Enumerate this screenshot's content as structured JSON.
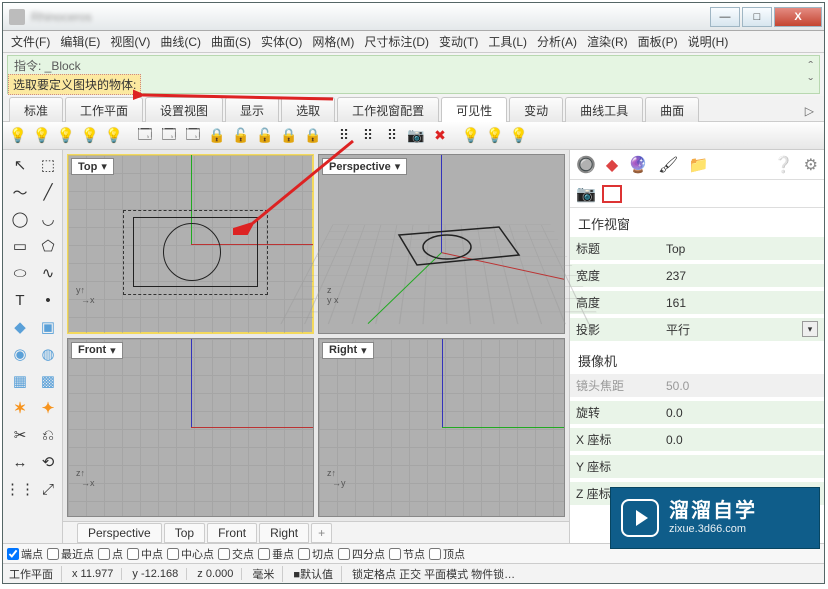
{
  "titlebar": {
    "title": "Rhinoceros"
  },
  "win_buttons": {
    "min": "—",
    "max": "□",
    "close": "X"
  },
  "menus": [
    "文件(F)",
    "编辑(E)",
    "视图(V)",
    "曲线(C)",
    "曲面(S)",
    "实体(O)",
    "网格(M)",
    "尺寸标注(D)",
    "变动(T)",
    "工具(L)",
    "分析(A)",
    "渲染(R)",
    "面板(P)",
    "说明(H)"
  ],
  "command": {
    "line1": "指令: _Block",
    "line2": "选取要定义图块的物体:"
  },
  "upper_tabs": [
    "标准",
    "工作平面",
    "设置视图",
    "显示",
    "选取",
    "工作视窗配置",
    "可见性",
    "变动",
    "曲线工具",
    "曲面"
  ],
  "upper_active_index": 6,
  "tab_more": "▷",
  "viewports": {
    "top": "Top",
    "perspective": "Perspective",
    "front": "Front",
    "right": "Right"
  },
  "view_tabs": [
    "Perspective",
    "Top",
    "Front",
    "Right"
  ],
  "view_tab_plus": "+",
  "right_panel": {
    "section1": "工作视窗",
    "rows1": [
      {
        "k": "标题",
        "v": "Top"
      },
      {
        "k": "宽度",
        "v": "237"
      },
      {
        "k": "高度",
        "v": "161"
      },
      {
        "k": "投影",
        "v": "平行",
        "dd": true
      }
    ],
    "section2": "摄像机",
    "rows2": [
      {
        "k": "镜头焦距",
        "v": "50.0",
        "dim": true
      },
      {
        "k": "旋转",
        "v": "0.0"
      },
      {
        "k": "X 座标",
        "v": "0.0"
      },
      {
        "k": "Y 座标",
        "v": ""
      },
      {
        "k": "Z 座标",
        "v": ""
      }
    ]
  },
  "osnap": {
    "items": [
      {
        "label": "端点",
        "checked": true
      },
      {
        "label": "最近点",
        "checked": false
      },
      {
        "label": "点",
        "checked": false
      },
      {
        "label": "中点",
        "checked": false
      },
      {
        "label": "中心点",
        "checked": false
      },
      {
        "label": "交点",
        "checked": false
      },
      {
        "label": "垂点",
        "checked": false
      },
      {
        "label": "切点",
        "checked": false
      },
      {
        "label": "四分点",
        "checked": false
      },
      {
        "label": "节点",
        "checked": false
      },
      {
        "label": "顶点",
        "checked": false
      }
    ]
  },
  "status": {
    "plane": "工作平面",
    "x": "x 11.977",
    "y": "y -12.168",
    "z": "z 0.000",
    "mm": "毫米",
    "default_btn": "■默认值",
    "rest": "锁定格点 正交 平面模式 物件锁…"
  },
  "badge": {
    "big": "溜溜自学",
    "small": "zixue.3d66.com"
  },
  "chart_data": null
}
